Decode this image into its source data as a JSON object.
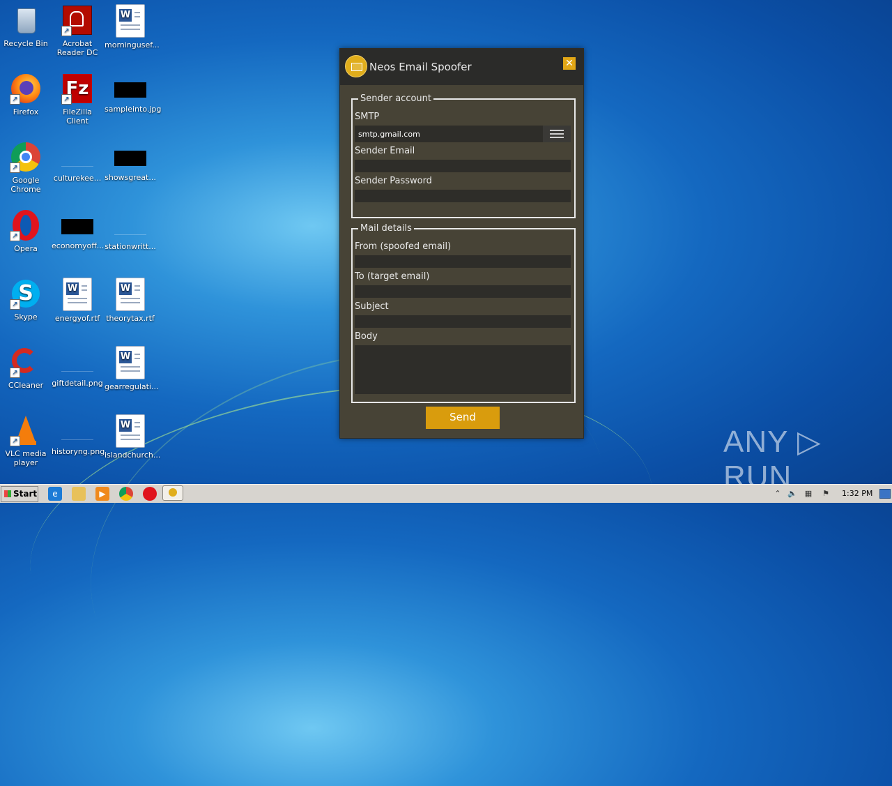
{
  "desktop_icons": [
    {
      "label": "Recycle Bin",
      "icon": "recycle-bin-icon"
    },
    {
      "label": "Acrobat\nReader DC",
      "icon": "acrobat-icon"
    },
    {
      "label": "morningusef...",
      "icon": "word-document-icon"
    },
    {
      "label": "Firefox",
      "icon": "firefox-icon"
    },
    {
      "label": "FileZilla Client",
      "icon": "filezilla-icon"
    },
    {
      "label": "sampleinto.jpg",
      "icon": "image-file-icon"
    },
    {
      "label": "Google\nChrome",
      "icon": "chrome-icon"
    },
    {
      "label": "culturekee...",
      "icon": "file-icon"
    },
    {
      "label": "showsgreat...",
      "icon": "file-icon"
    },
    {
      "label": "Opera",
      "icon": "opera-icon"
    },
    {
      "label": "economyoff...",
      "icon": "file-icon"
    },
    {
      "label": "stationwritt...",
      "icon": "file-icon"
    },
    {
      "label": "Skype",
      "icon": "skype-icon"
    },
    {
      "label": "energyof.rtf",
      "icon": "word-document-icon"
    },
    {
      "label": "theorytax.rtf",
      "icon": "word-document-icon"
    },
    {
      "label": "CCleaner",
      "icon": "ccleaner-icon"
    },
    {
      "label": "giftdetail.png",
      "icon": "image-file-icon"
    },
    {
      "label": "gearregulati...",
      "icon": "word-document-icon"
    },
    {
      "label": "VLC media\nplayer",
      "icon": "vlc-icon"
    },
    {
      "label": "historyng.png",
      "icon": "image-file-icon"
    },
    {
      "label": "islandchurch...",
      "icon": "word-document-icon"
    }
  ],
  "window": {
    "title": "Neos Email Spoofer",
    "close_label": "✕",
    "sender_account": {
      "legend": "Sender account",
      "smtp_label": "SMTP",
      "smtp_value": "smtp.gmail.com",
      "sender_email_label": "Sender Email",
      "sender_email_value": "",
      "sender_password_label": "Sender Password",
      "sender_password_value": ""
    },
    "mail_details": {
      "legend": "Mail details",
      "from_label": "From (spoofed email)",
      "from_value": "",
      "to_label": "To (target email)",
      "to_value": "",
      "subject_label": "Subject",
      "subject_value": "",
      "body_label": "Body",
      "body_value": ""
    },
    "send_label": "Send"
  },
  "watermark": "ANY ▷ RUN",
  "taskbar": {
    "start_label": "Start",
    "pinned": [
      "internet-explorer-icon",
      "file-explorer-icon",
      "media-player-icon",
      "chrome-icon",
      "opera-icon",
      "neos-email-spoofer-icon"
    ],
    "tray_up_arrow": "⌃",
    "clock": "1:32 PM"
  },
  "colors": {
    "window_bg": "#474336",
    "titlebar_bg": "#2b2b29",
    "accent": "#d99c0d",
    "field_bg": "#2e2d29"
  }
}
